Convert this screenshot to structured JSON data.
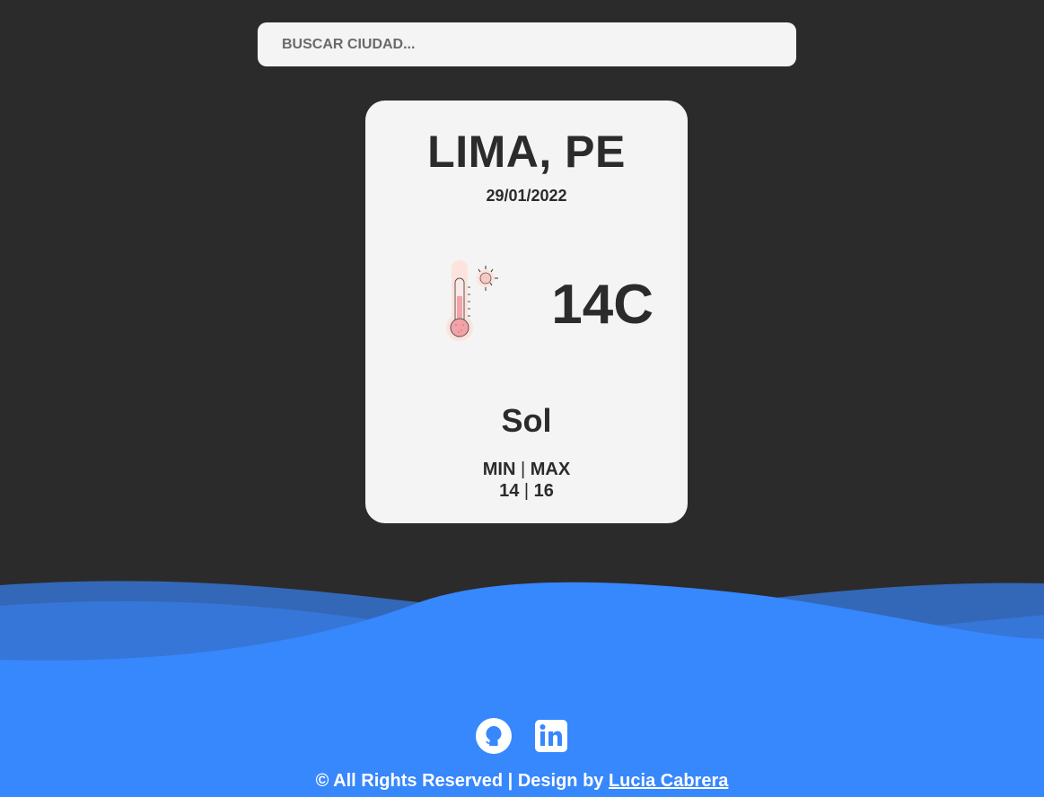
{
  "search": {
    "placeholder": "BUSCAR CIUDAD...",
    "value": ""
  },
  "card": {
    "city": "LIMA, PE",
    "date": "29/01/2022",
    "temperature": "14C",
    "description": "Sol",
    "minmax_label_min": "MIN",
    "minmax_label_sep": "|",
    "minmax_label_max": "MAX",
    "min_value": "14",
    "max_value": "16",
    "icon": "thermometer-sun-icon"
  },
  "footer": {
    "icons": [
      "github-icon",
      "linkedin-icon"
    ],
    "copyright_text": "© All Rights Reserved | Design by ",
    "author_link": "Lucia Cabrera"
  },
  "colors": {
    "background": "#2b2b2b",
    "card": "#f3f4f3",
    "text": "#2b2b2b",
    "footer_blue": "#3787fd",
    "wave_dark": "#3368b8"
  }
}
